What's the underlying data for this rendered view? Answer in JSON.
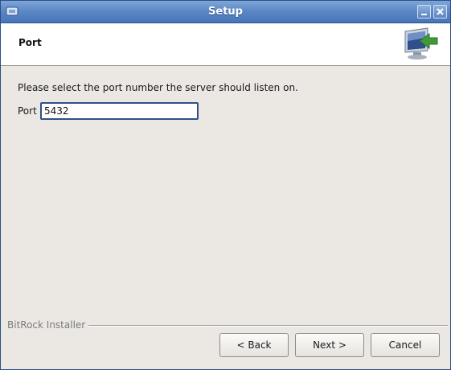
{
  "window": {
    "title": "Setup",
    "app_icon": "installer-app-icon",
    "controls": {
      "minimize_icon": "minimize-icon",
      "close_icon": "close-icon"
    }
  },
  "header": {
    "title": "Port",
    "logo_icon": "computer-arrow-icon"
  },
  "main": {
    "instruction": "Please select the port number the server should listen on.",
    "port_label": "Port",
    "port_value": "5432"
  },
  "footer": {
    "brand": "BitRock Installer",
    "back_label": "< Back",
    "next_label": "Next >",
    "cancel_label": "Cancel"
  },
  "colors": {
    "titlebar": "#5d89c6",
    "dialog_bg": "#ebe8e4",
    "input_focus_border": "#2f4f8a"
  }
}
